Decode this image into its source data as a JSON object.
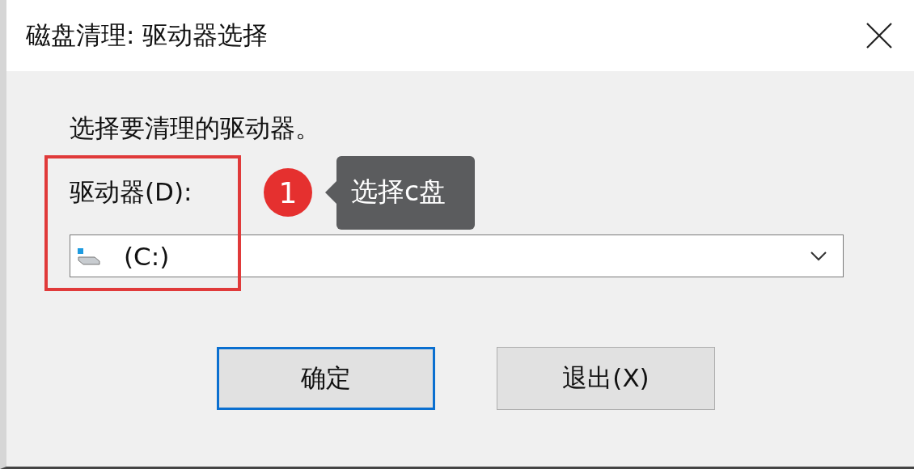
{
  "window": {
    "title": "磁盘清理: 驱动器选择"
  },
  "instruction": "选择要清理的驱动器。",
  "drive_label": "驱动器(D):",
  "drive_dropdown": {
    "value": "(C:)"
  },
  "annotation": {
    "badge": "1",
    "callout": "选择c盘"
  },
  "buttons": [
    {
      "label": "确定",
      "focused": true
    },
    {
      "label": "退出(X)",
      "focused": false
    }
  ]
}
